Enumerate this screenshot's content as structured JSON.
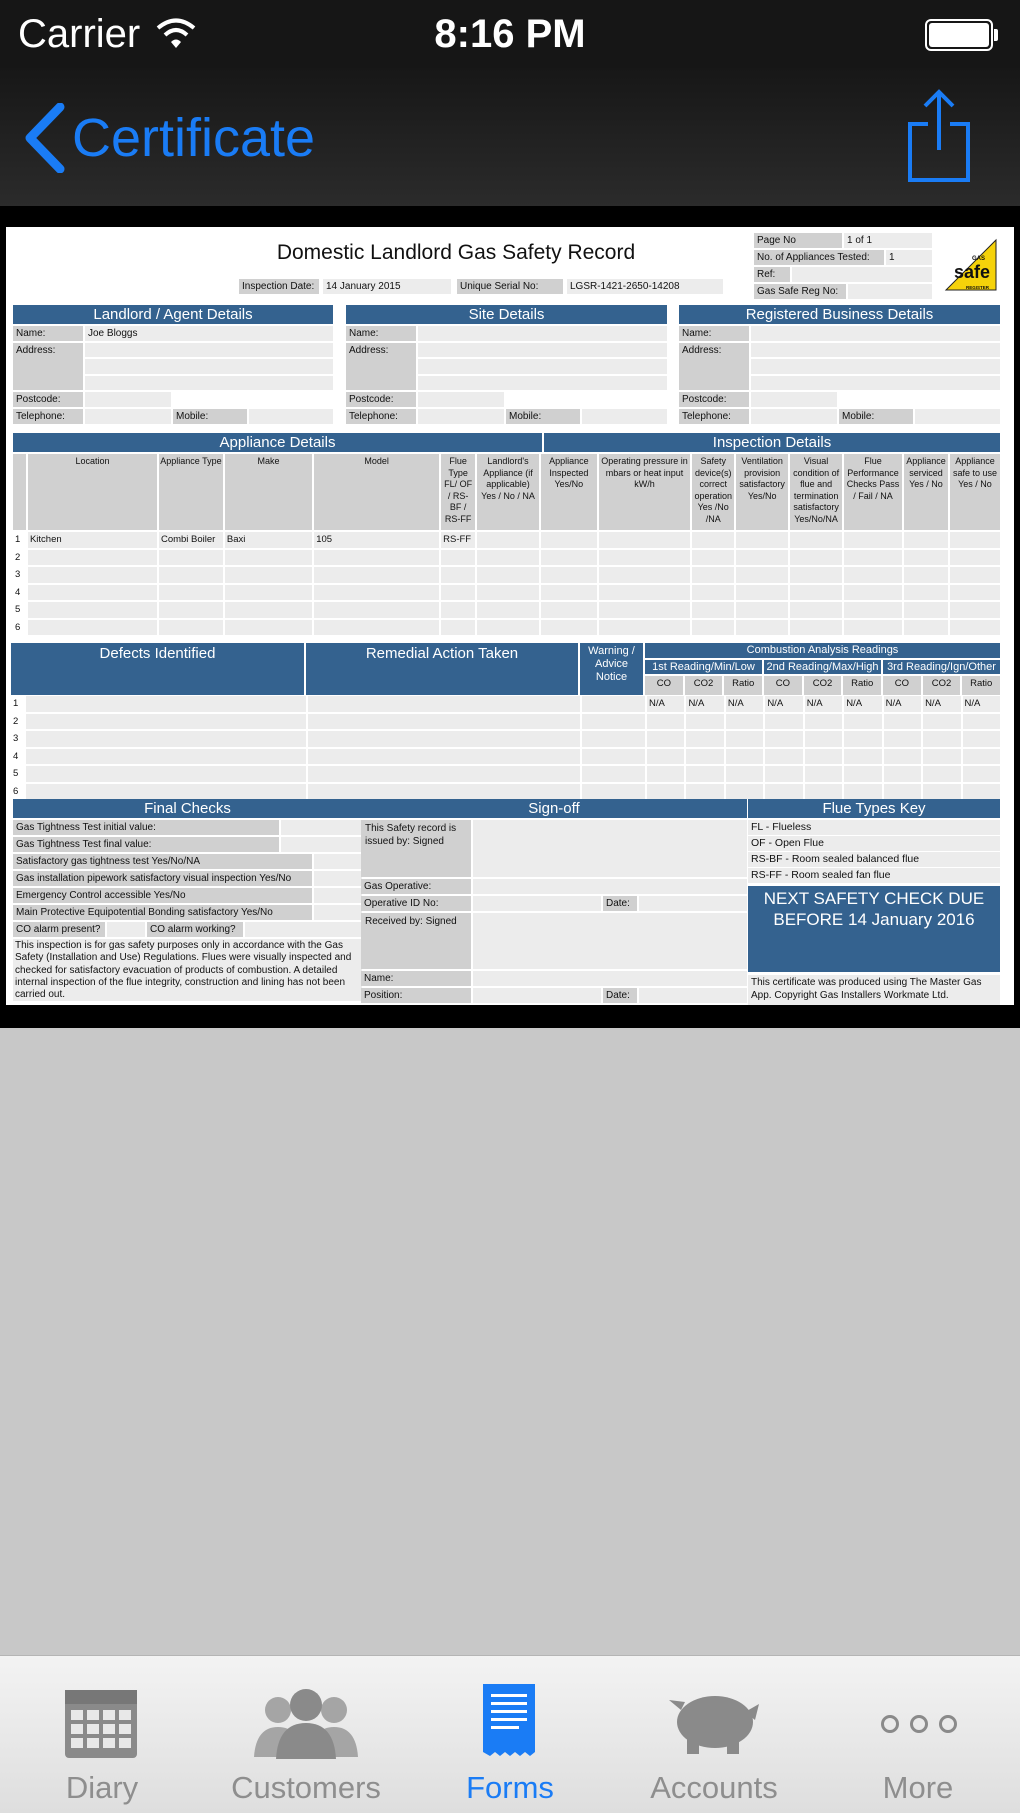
{
  "status_bar": {
    "carrier": "Carrier",
    "time": "8:16 PM"
  },
  "nav": {
    "back_label": "Certificate",
    "share_icon": "share-icon"
  },
  "doc": {
    "title": "Domestic Landlord Gas Safety Record",
    "inspection_date_label": "Inspection Date:",
    "inspection_date": "14 January 2015",
    "serial_label": "Unique Serial No:",
    "serial": "LGSR-1421-2650-14208",
    "page_no_label": "Page No",
    "page_no": "1 of 1",
    "appliances_tested_label": "No. of Appliances Tested:",
    "appliances_tested": "1",
    "ref_label": "Ref:",
    "gas_safe_label": "Gas Safe Reg No:",
    "logo": {
      "small": "GAS",
      "big": "safe",
      "sub": "REGISTER"
    },
    "landlord": {
      "header": "Landlord / Agent Details",
      "name_label": "Name:",
      "name": "Joe Bloggs",
      "address_label": "Address:",
      "postcode_label": "Postcode:",
      "telephone_label": "Telephone:",
      "mobile_label": "Mobile:"
    },
    "site": {
      "header": "Site Details",
      "name_label": "Name:",
      "address_label": "Address:",
      "postcode_label": "Postcode:",
      "telephone_label": "Telephone:",
      "mobile_label": "Mobile:"
    },
    "business": {
      "header": "Registered Business Details",
      "name_label": "Name:",
      "address_label": "Address:",
      "postcode_label": "Postcode:",
      "telephone_label": "Telephone:",
      "mobile_label": "Mobile:"
    },
    "appliance_header": "Appliance Details",
    "inspection_header": "Inspection Details",
    "appliance_columns": [
      "Location",
      "Appliance Type",
      "Make",
      "Model",
      "Flue Type FL/ OF / RS-BF / RS-FF",
      "Landlord's Appliance (if applicable) Yes / No / NA",
      "Appliance Inspected Yes/No",
      "Operating pressure in mbars or heat input kW/h",
      "Safety device(s) correct operation Yes /No /NA",
      "Ventilation provision satisfactory Yes/No",
      "Visual condition of flue and termination satisfactory Yes/No/NA",
      "Flue Performance Checks Pass / Fail / NA",
      "Appliance serviced Yes / No",
      "Appliance safe to use Yes / No"
    ],
    "appliance_rows": [
      {
        "n": "1",
        "location": "Kitchen",
        "type": "Combi Boiler",
        "make": "Baxi",
        "model": "105",
        "flue": "RS-FF"
      },
      {
        "n": "2"
      },
      {
        "n": "3"
      },
      {
        "n": "4"
      },
      {
        "n": "5"
      },
      {
        "n": "6"
      }
    ],
    "defects_header": "Defects Identified",
    "remedial_header": "Remedial Action Taken",
    "warning_header": "Warning / Advice Notice",
    "combustion_header": "Combustion Analysis Readings",
    "readings": [
      "1st Reading/Min/Low",
      "2nd Reading/Max/High",
      "3rd Reading/Ign/Other"
    ],
    "reading_cols": [
      "CO",
      "CO2",
      "Ratio",
      "CO",
      "CO2",
      "Ratio",
      "CO",
      "CO2",
      "Ratio"
    ],
    "defect_rows": [
      {
        "n": "1",
        "values": [
          "N/A",
          "N/A",
          "N/A",
          "N/A",
          "N/A",
          "N/A",
          "N/A",
          "N/A",
          "N/A"
        ]
      },
      {
        "n": "2"
      },
      {
        "n": "3"
      },
      {
        "n": "4"
      },
      {
        "n": "5"
      },
      {
        "n": "6"
      }
    ],
    "final_checks": {
      "header": "Final Checks",
      "items": [
        "Gas Tightness Test initial value:",
        "Gas Tightness Test final value:",
        "Satisfactory gas tightness test Yes/No/NA",
        "Gas installation pipework satisfactory visual inspection Yes/No",
        "Emergency Control accessible Yes/No",
        "Main Protective Equipotential Bonding satisfactory Yes/No"
      ],
      "co_present": "CO alarm present?",
      "co_working": "CO alarm working?",
      "note": "This inspection is for gas safety purposes only in accordance with the Gas Safety (Installation and Use) Regulations. Flues were visually inspected and checked for satisfactory evacuation of products of combustion. A detailed internal inspection of the flue integrity, construction and lining has not been carried out."
    },
    "signoff": {
      "header": "Sign-off",
      "issued_by": "This Safety record is issued by: Signed",
      "gas_operative": "Gas Operative:",
      "operative_id": "Operative ID No:",
      "date_label": "Date:",
      "received_by": "Received by: Signed",
      "name_label": "Name:",
      "position_label": "Position:",
      "date_label2": "Date:"
    },
    "flue_key": {
      "header": "Flue Types Key",
      "items": [
        "FL - Flueless",
        "OF - Open Flue",
        "RS-BF - Room sealed balanced flue",
        "RS-FF - Room sealed fan flue"
      ]
    },
    "next_check": "NEXT SAFETY CHECK DUE BEFORE 14 January 2016",
    "footer_note": "This certificate was produced using The Master Gas App. Copyright Gas Installers Workmate Ltd."
  },
  "tabs": [
    {
      "label": "Diary",
      "icon": "calendar-icon",
      "active": false
    },
    {
      "label": "Customers",
      "icon": "people-icon",
      "active": false
    },
    {
      "label": "Forms",
      "icon": "form-icon",
      "active": true
    },
    {
      "label": "Accounts",
      "icon": "piggy-bank-icon",
      "active": false
    },
    {
      "label": "More",
      "icon": "more-icon",
      "active": false
    }
  ],
  "colors": {
    "accent": "#1a7cf5",
    "header_blue": "#34628f",
    "tab_inactive": "#8e8e8e"
  }
}
